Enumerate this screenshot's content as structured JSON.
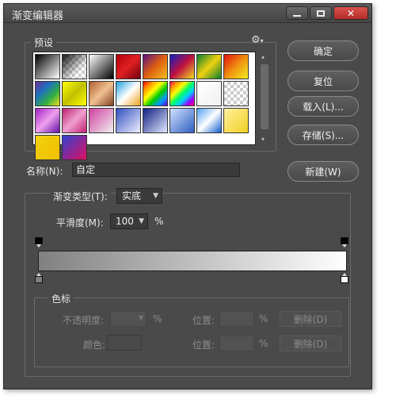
{
  "window": {
    "title": "渐变编辑器"
  },
  "presets": {
    "label": "预设",
    "gear_icon": "gear-icon",
    "swatches": [
      {
        "css": "linear-gradient(135deg,#000,#fff)"
      },
      {
        "css": "checker-black"
      },
      {
        "css": "linear-gradient(135deg,#fff,#000)"
      },
      {
        "css": "linear-gradient(135deg,#b00010,#e02020,#700010)"
      },
      {
        "css": "linear-gradient(135deg,#5a1080,#e06010,#f0c020)"
      },
      {
        "css": "linear-gradient(135deg,#1020c0,#c01040,#f0e020)"
      },
      {
        "css": "linear-gradient(135deg,#0a8030,#f0d010,#0a8030)"
      },
      {
        "css": "linear-gradient(135deg,#e01010,#f09010,#f0f020)"
      },
      {
        "css": "linear-gradient(135deg,#6a3090,#2070c0,#30b040,#f0e020)"
      },
      {
        "css": "linear-gradient(135deg,#ff0,#c0c000,#ff0)"
      },
      {
        "css": "linear-gradient(135deg,#b06030,#f0c090,#804020)"
      },
      {
        "css": "linear-gradient(135deg,#20a0e0,#fff,#f0a020)"
      },
      {
        "css": "linear-gradient(135deg,#f00,#f90,#ff0,#0c0,#09f,#60c)"
      },
      {
        "css": "linear-gradient(135deg,#f06,#f90,#ff0,#0f6,#0cf,#90f,#f06)"
      },
      {
        "css": "linear-gradient(135deg,#fff,#f0f0f0)"
      },
      {
        "css": "checker-plain"
      },
      {
        "css": "linear-gradient(135deg,#a020c0,#f0a0f0,#6010a0)"
      },
      {
        "css": "linear-gradient(135deg,#c02070,#f0a0d0,#c02070)"
      },
      {
        "css": "linear-gradient(135deg,#d040a0,#f0f0f0)"
      },
      {
        "css": "linear-gradient(135deg,#3050c0,#f0f0ff)"
      },
      {
        "css": "linear-gradient(135deg,#102080,#e0e8ff)"
      },
      {
        "css": "linear-gradient(135deg,#d0e0ff,#3060c0)"
      },
      {
        "css": "linear-gradient(135deg,#50a0f0,#fff,#1060d0)"
      },
      {
        "css": "linear-gradient(135deg,#fff0a0,#f0d020)"
      },
      {
        "css": "linear-gradient(135deg,#f0d010,#f0c000)"
      },
      {
        "css": "linear-gradient(135deg,#3040d0,#e01060)"
      }
    ]
  },
  "buttons": {
    "ok": "确定",
    "reset": "复位",
    "load": "载入(L)...",
    "save": "存储(S)...",
    "new": "新建(W)"
  },
  "name": {
    "label": "名称(N):",
    "value": "自定"
  },
  "gradient": {
    "type_label": "渐变类型(T):",
    "type_value": "实底",
    "smooth_label": "平滑度(M):",
    "smooth_value": "100",
    "smooth_unit": "%",
    "color_start": "#808080",
    "color_end": "#ffffff"
  },
  "color_stops": {
    "label": "色标",
    "opacity_label": "不透明度:",
    "opacity_unit": "%",
    "location_label": "位置:",
    "location_unit": "%",
    "delete_label": "删除(D)",
    "color_label": "颜色:",
    "location2_label": "位置:",
    "location2_unit": "%",
    "delete2_label": "删除(D)"
  }
}
